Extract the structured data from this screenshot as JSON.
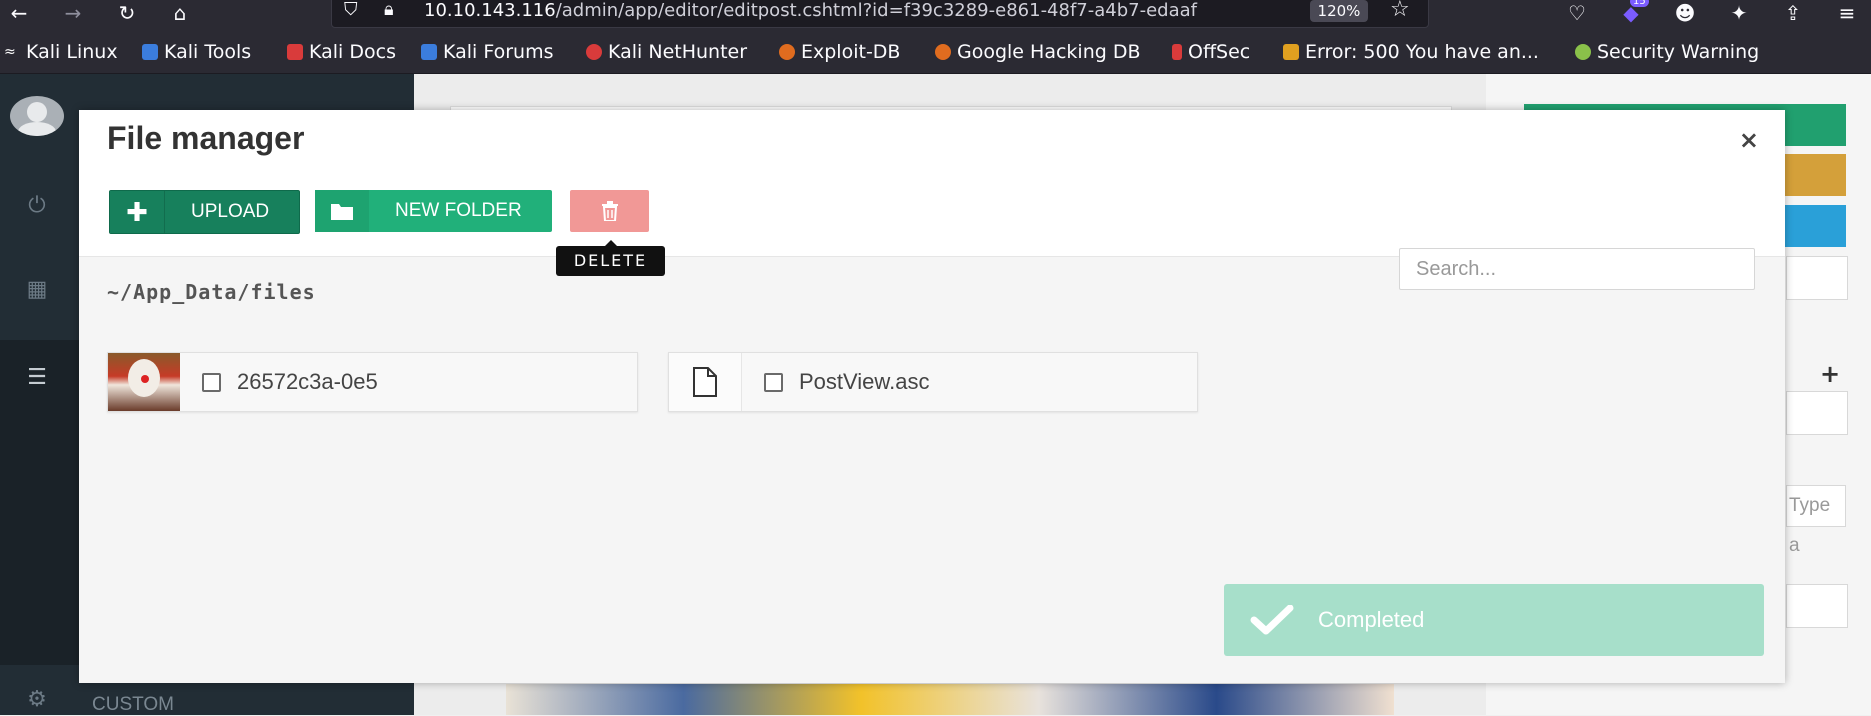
{
  "browser": {
    "url_host": "10.10.143.116",
    "url_path": "/admin/app/editor/editpost.cshtml?id=f39c3289-e861-48f7-a4b7-edaaf",
    "zoom": "120%",
    "badge_count": "15"
  },
  "bookmarks": [
    {
      "label": "Kali Linux",
      "color": "#3b7ddd"
    },
    {
      "label": "Kali Tools",
      "color": "#3b7ddd"
    },
    {
      "label": "Kali Docs",
      "color": "#d93b3b"
    },
    {
      "label": "Kali Forums",
      "color": "#3b7ddd"
    },
    {
      "label": "Kali NetHunter",
      "color": "#d93b3b"
    },
    {
      "label": "Exploit-DB",
      "color": "#e06c1f"
    },
    {
      "label": "Google Hacking DB",
      "color": "#e06c1f"
    },
    {
      "label": "OffSec",
      "color": "#d93b3b"
    },
    {
      "label": "Error: 500 You have an...",
      "color": "#e0a020"
    },
    {
      "label": "Security Warning",
      "color": "#8ac14a"
    }
  ],
  "modal": {
    "title": "File manager",
    "close": "×",
    "upload_label": "UPLOAD",
    "new_folder_label": "NEW FOLDER",
    "delete_tooltip": "DELETE",
    "search_placeholder": "Search...",
    "path": "~/App_Data/files",
    "files": [
      {
        "name": "26572c3a-0e5",
        "type": "image"
      },
      {
        "name": "PostView.asc",
        "type": "file"
      }
    ],
    "toast": "Completed"
  },
  "sidebar": {
    "custom_label": "CUSTOM"
  },
  "right_panel": {
    "type_placeholder": "Type a",
    "colors": {
      "green": "#21a06f",
      "orange": "#d4a03a",
      "blue": "#2aa0d8"
    }
  }
}
